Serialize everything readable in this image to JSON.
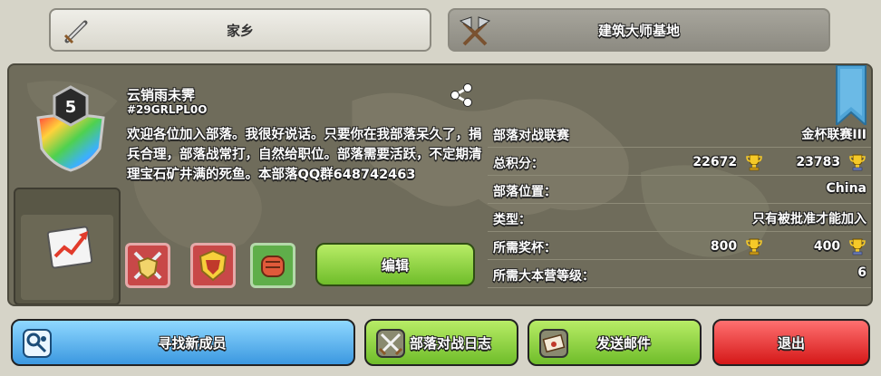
{
  "tabs": {
    "home_label": "家乡",
    "builder_label": "建筑大师基地"
  },
  "clan": {
    "level": "5",
    "name": "云销雨未霁",
    "tag": "#29GRLPL0O",
    "description": "欢迎各位加入部落。我很好说话。只要你在我部落呆久了，捐兵合理，部落战常打，自然给职位。部落需要活跃，不定期清理宝石矿井满的死鱼。本部落QQ群648742463"
  },
  "actions": {
    "edit_label": "编辑"
  },
  "info": {
    "war_league_label": "部落对战联赛",
    "war_league_value": "金杯联赛III",
    "total_points_label": "总积分：",
    "total_points_home": "22672",
    "total_points_builder": "23783",
    "location_label": "部落位置：",
    "location_value": "China",
    "type_label": "类型：",
    "type_value": "只有被批准才能加入",
    "required_trophies_label": "所需奖杯：",
    "required_trophies_home": "800",
    "required_trophies_builder": "400",
    "required_th_label": "所需大本营等级：",
    "required_th_value": "6"
  },
  "buttons": {
    "find_members": "寻找新成员",
    "war_log": "部落对战日志",
    "send_mail": "发送邮件",
    "exit": "退出"
  },
  "icons": {
    "home_tab": "sword-icon",
    "builder_tab": "crossed-axes-icon",
    "share": "share-icon",
    "trend": "trend-chart-icon",
    "perk1": "crossed-swords-shield-icon",
    "perk2": "gold-crest-icon",
    "perk3": "fist-icon",
    "trophy": "trophy-icon",
    "builder_trophy": "builder-trophy-icon",
    "find": "search-person-icon",
    "war": "crossed-swords-icon",
    "mail": "mail-icon"
  },
  "colors": {
    "panel_bg": "#6f6c5b",
    "green_button": "#6fbd2a",
    "blue_button": "#3b98e0",
    "red_button": "#d51818",
    "ribbon": "#4fa5d8"
  }
}
